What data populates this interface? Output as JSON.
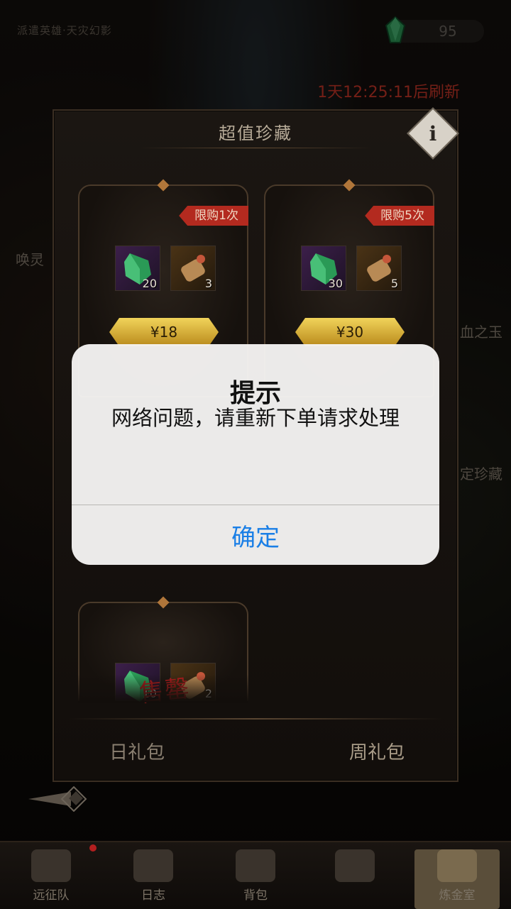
{
  "top": {
    "left_text": "派遣英雄·天灾幻影",
    "currency_value": "95",
    "refresh_text": "1天12:25:11后刷新"
  },
  "side_labels": {
    "left": "唤灵",
    "right_1": "血之玉",
    "right_2": "定珍藏"
  },
  "panel": {
    "title": "超值珍藏",
    "info_label": "i"
  },
  "cards": [
    {
      "limit": "限购1次",
      "items": [
        {
          "icon": "green-gem",
          "count": "20"
        },
        {
          "icon": "scroll",
          "count": "3"
        }
      ],
      "price": "¥18"
    },
    {
      "limit": "限购5次",
      "items": [
        {
          "icon": "green-gem",
          "count": "30"
        },
        {
          "icon": "scroll",
          "count": "5"
        }
      ],
      "price": "¥30"
    },
    {
      "sold_label": "售罄",
      "items": [
        {
          "icon": "green-gem",
          "count": "10"
        },
        {
          "icon": "scroll",
          "count": "2"
        }
      ]
    }
  ],
  "tabs": [
    {
      "label": "日礼包"
    },
    {
      "label": "周礼包"
    }
  ],
  "bottom_nav": [
    {
      "label": "远征队",
      "icon": "helmet-icon"
    },
    {
      "label": "日志",
      "icon": "scroll-icon"
    },
    {
      "label": "背包",
      "icon": "bag-icon"
    },
    {
      "label": "",
      "icon": "unknown"
    },
    {
      "label": "炼金室",
      "icon": "alchemy-icon"
    }
  ],
  "alert": {
    "title": "提示",
    "message": "网络问题，请重新下单请求处理",
    "confirm_label": "确定"
  },
  "colors": {
    "refresh_red": "#d33a2a",
    "limit_badge": "#b32a1f",
    "price_gold": "#f1d35a",
    "alert_button_blue": "#1a7fe6"
  }
}
